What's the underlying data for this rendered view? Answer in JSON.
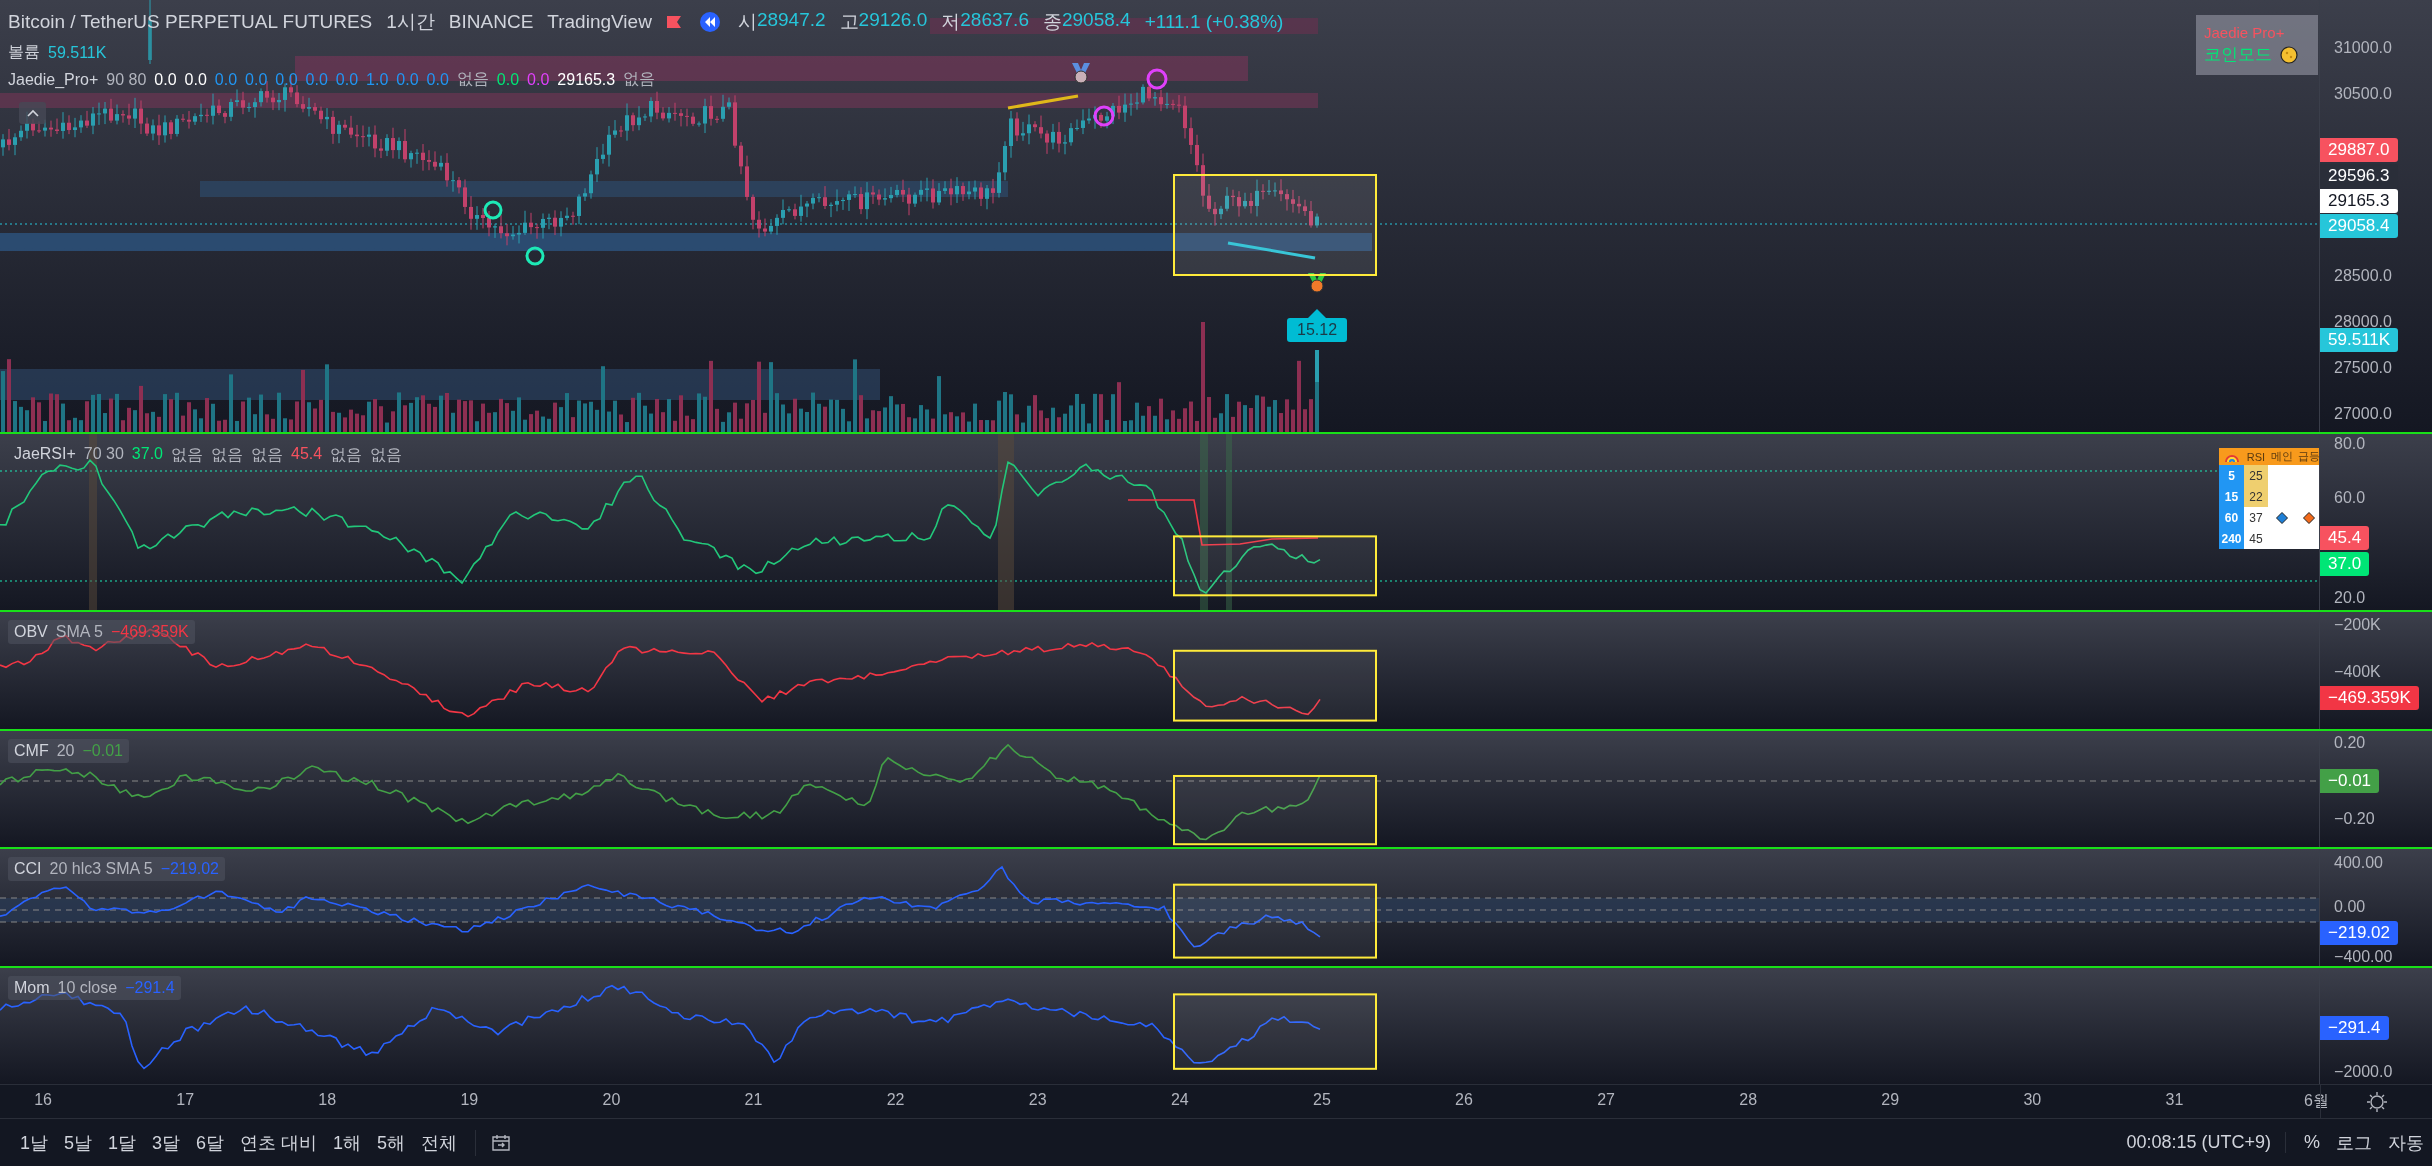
{
  "header": {
    "symbol": "Bitcoin / TetherUS PERPETUAL FUTURES",
    "interval": "1시간",
    "exchange": "BINANCE",
    "source": "TradingView",
    "ohlc": [
      {
        "label": "시",
        "value": "28947.2"
      },
      {
        "label": "고",
        "value": "29126.0"
      },
      {
        "label": "저",
        "value": "28637.6"
      },
      {
        "label": "종",
        "value": "29058.4"
      }
    ],
    "change": "+111.1 (+0.38%)"
  },
  "volume_legend": {
    "label": "볼륨",
    "value": "59.511K"
  },
  "indicator_legend": {
    "name": "Jaedie_Pro+",
    "params": "90 80",
    "values": [
      {
        "text": "0.0",
        "color": "#ffffff"
      },
      {
        "text": "0.0",
        "color": "#ffffff"
      },
      {
        "text": "0.0",
        "color": "#2196f3"
      },
      {
        "text": "0.0",
        "color": "#2196f3"
      },
      {
        "text": "0.0",
        "color": "#2196f3"
      },
      {
        "text": "0.0",
        "color": "#2196f3"
      },
      {
        "text": "0.0",
        "color": "#2196f3"
      },
      {
        "text": "1.0",
        "color": "#2196f3"
      },
      {
        "text": "0.0",
        "color": "#2196f3"
      },
      {
        "text": "0.0",
        "color": "#2196f3"
      },
      {
        "text": "없음",
        "color": "#b2b5be"
      },
      {
        "text": "0.0",
        "color": "#00e676"
      },
      {
        "text": "0.0",
        "color": "#e040fb"
      },
      {
        "text": "29165.3",
        "color": "#ffffff"
      },
      {
        "text": "없음",
        "color": "#b2b5be"
      }
    ]
  },
  "overlay_badge": {
    "title": "Jaedie Pro+",
    "mode": "코인모드"
  },
  "price_axis": {
    "labels": [
      "31000.0",
      "30500.0",
      "28500.0",
      "28000.0",
      "27500.0",
      "27000.0"
    ],
    "tags": [
      {
        "text": "29887.0",
        "color": "#f7525f"
      },
      {
        "text": "29596.3",
        "color": "#2a2e39"
      },
      {
        "text": "29165.3",
        "color": "#ffffff"
      },
      {
        "text": "29058.4",
        "color": "#26c6da"
      },
      {
        "text": "59.511K",
        "color": "#26c6da"
      }
    ]
  },
  "signal_tag": "15.12",
  "panes": [
    {
      "kind": "rsi",
      "name": "JaeRSI+",
      "params": "70 30",
      "values": [
        {
          "text": "37.0",
          "color": "#00e676"
        },
        {
          "text": "없음",
          "color": "#b2b5be"
        },
        {
          "text": "없음",
          "color": "#b2b5be"
        },
        {
          "text": "없음",
          "color": "#b2b5be"
        },
        {
          "text": "45.4",
          "color": "#f7525f"
        },
        {
          "text": "없음",
          "color": "#b2b5be"
        },
        {
          "text": "없음",
          "color": "#b2b5be"
        }
      ],
      "axis_labels": [
        "80.0",
        "60.0",
        "20.0"
      ],
      "tags": [
        {
          "text": "45.4",
          "color": "#f7525f"
        },
        {
          "text": "37.0",
          "color": "#00e676"
        }
      ]
    },
    {
      "kind": "obv",
      "name": "OBV",
      "params": "SMA 5",
      "values": [
        {
          "text": "−469.359K",
          "color": "#f23645"
        }
      ],
      "axis_labels": [
        "−200K",
        "−400K"
      ],
      "tags": [
        {
          "text": "−469.359K",
          "color": "#f23645"
        }
      ]
    },
    {
      "kind": "cmf",
      "name": "CMF",
      "params": "20",
      "values": [
        {
          "text": "−0.01",
          "color": "#43a047"
        }
      ],
      "axis_labels": [
        "0.20",
        "−0.20"
      ],
      "tags": [
        {
          "text": "−0.01",
          "color": "#43a047"
        }
      ]
    },
    {
      "kind": "cci",
      "name": "CCI",
      "params": "20 hlc3 SMA 5",
      "values": [
        {
          "text": "−219.02",
          "color": "#2962ff"
        }
      ],
      "axis_labels": [
        "400.00",
        "0.00",
        "−400.00"
      ],
      "tags": [
        {
          "text": "−219.02",
          "color": "#2962ff"
        }
      ]
    },
    {
      "kind": "mom",
      "name": "Mom",
      "params": "10 close",
      "values": [
        {
          "text": "−291.4",
          "color": "#2962ff"
        }
      ],
      "axis_labels": [
        "−2000.0"
      ],
      "tags": [
        {
          "text": "−291.4",
          "color": "#2962ff"
        }
      ]
    }
  ],
  "rsi_table": {
    "header": [
      "RSI",
      "메인",
      "급등"
    ],
    "rows": [
      {
        "period": "5",
        "rsi": "25",
        "highlight": true,
        "main": false,
        "surge": false
      },
      {
        "period": "15",
        "rsi": "22",
        "highlight": true,
        "main": false,
        "surge": false
      },
      {
        "period": "60",
        "rsi": "37",
        "highlight": false,
        "main": true,
        "surge": true
      },
      {
        "period": "240",
        "rsi": "45",
        "highlight": false,
        "main": false,
        "surge": false
      }
    ]
  },
  "time_axis": [
    "16",
    "17",
    "18",
    "19",
    "20",
    "21",
    "22",
    "23",
    "24",
    "25",
    "26",
    "27",
    "28",
    "29",
    "30",
    "31",
    "6월"
  ],
  "bottom_toolbar": {
    "ranges": [
      "1날",
      "5날",
      "1달",
      "3달",
      "6달",
      "연초 대비",
      "1해",
      "5해",
      "전체"
    ],
    "clock": "00:08:15 (UTC+9)",
    "options": [
      "%",
      "로그",
      "자동"
    ]
  }
}
